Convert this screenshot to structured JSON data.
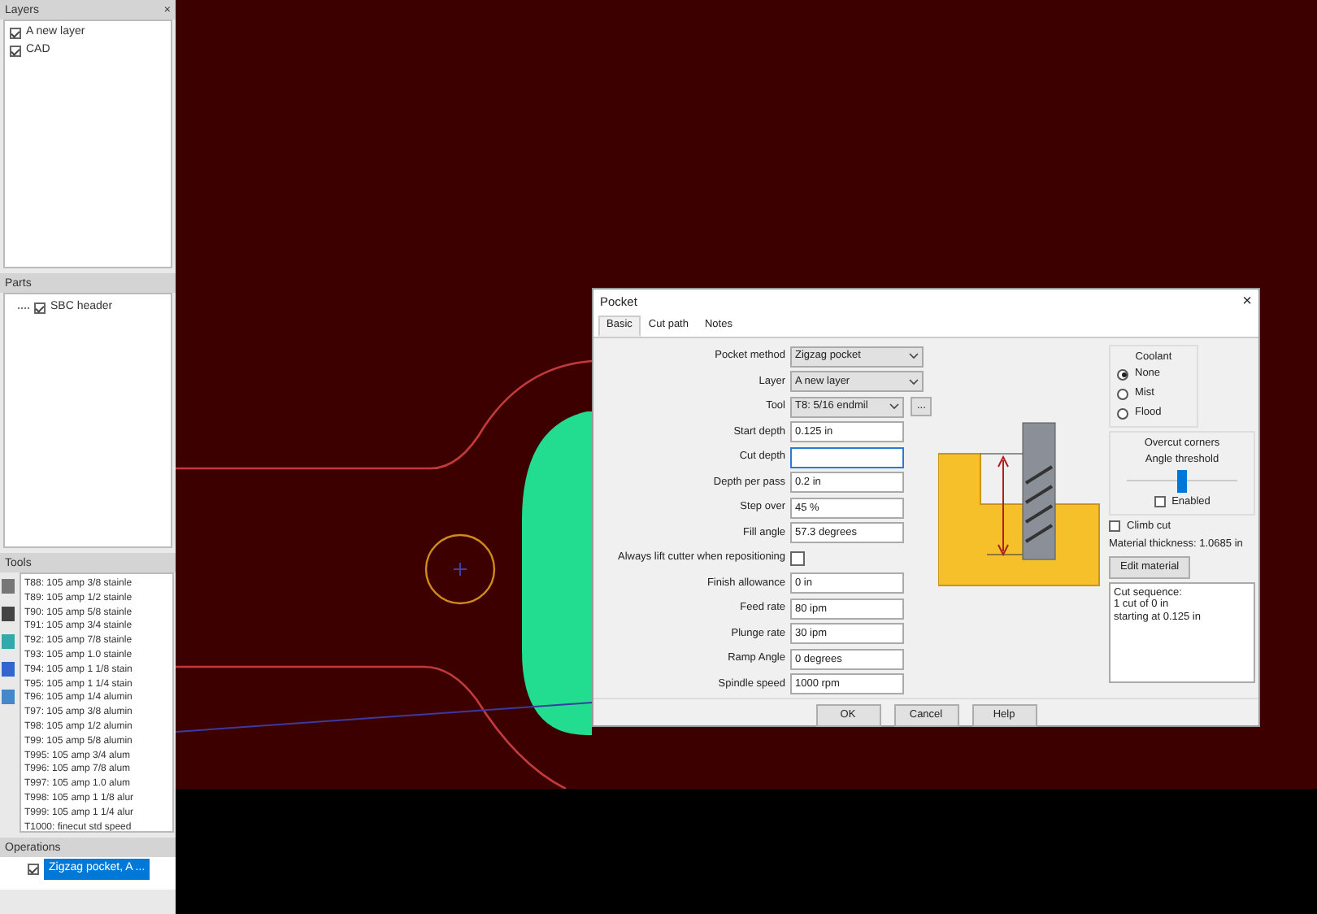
{
  "layers_panel": {
    "title": "Layers",
    "close": "×",
    "items": [
      {
        "label": "A new layer",
        "checked": true
      },
      {
        "label": "CAD",
        "checked": true
      }
    ]
  },
  "parts_panel": {
    "title": "Parts",
    "items": [
      {
        "label": "SBC header",
        "checked": true
      }
    ]
  },
  "tools_panel": {
    "title": "Tools",
    "items": [
      "T88: 105 amp 3/8 stainle",
      "T89: 105 amp 1/2 stainle",
      "T90: 105 amp 5/8 stainle",
      "T91: 105 amp 3/4 stainle",
      "T92: 105 amp 7/8 stainle",
      "T93: 105 amp 1.0 stainle",
      "T94: 105 amp 1 1/8 stain",
      "T95: 105 amp 1 1/4 stain",
      "T96: 105 amp 1/4 alumin",
      "T97: 105 amp 3/8 alumin",
      "T98: 105 amp 1/2 alumin",
      "T99: 105 amp 5/8 alumin",
      "T995: 105 amp 3/4 alum",
      "T996: 105 amp 7/8 alum",
      "T997: 105 amp 1.0 alum",
      "T998: 105 amp 1 1/8 alur",
      "T999: 105 amp 1 1/4 alur",
      "T1000: finecut std speed"
    ]
  },
  "operations_panel": {
    "title": "Operations",
    "items": [
      {
        "label": "Zigzag pocket, A ...",
        "checked": true,
        "selected": true
      }
    ]
  },
  "dialog": {
    "title": "Pocket",
    "close": "×",
    "tabs": [
      {
        "label": "Basic",
        "selected": true
      },
      {
        "label": "Cut path",
        "selected": false
      },
      {
        "label": "Notes",
        "selected": false
      }
    ],
    "fields": [
      {
        "kind": "select",
        "label": "Pocket method",
        "value": "Zigzag pocket"
      },
      {
        "kind": "select",
        "label": "Layer",
        "value": "A new layer"
      },
      {
        "kind": "select_button",
        "label": "Tool",
        "value": "T8: 5/16 endmil",
        "button": "..."
      },
      {
        "kind": "text",
        "label": "Start depth",
        "value": "0.125 in",
        "focused": false
      },
      {
        "kind": "text",
        "label": "Cut depth",
        "focused": true
      },
      {
        "kind": "text",
        "label": "Depth per pass",
        "value": "0.2 in",
        "focused": false
      },
      {
        "kind": "text",
        "label": "Step over",
        "value": "45 %",
        "focused": false
      },
      {
        "kind": "text",
        "label": "Fill angle",
        "value": "57.3 degrees",
        "focused": false
      },
      {
        "kind": "checkbox",
        "label": "Always lift cutter when repositioning",
        "checked": false
      },
      {
        "kind": "text",
        "label": "Finish allowance",
        "value": "0 in",
        "focused": false
      },
      {
        "kind": "text",
        "label": "Feed rate",
        "value": "80 ipm",
        "focused": false
      },
      {
        "kind": "text",
        "label": "Plunge rate",
        "value": "30 ipm",
        "focused": false
      },
      {
        "kind": "text",
        "label": "Ramp Angle",
        "value": "0 degrees",
        "focused": false
      },
      {
        "kind": "text",
        "label": "Spindle speed",
        "value": "1000 rpm",
        "focused": false
      }
    ],
    "coolant": {
      "title": "Coolant",
      "options": [
        {
          "label": "None",
          "selected": true
        },
        {
          "label": "Mist",
          "selected": false
        },
        {
          "label": "Flood",
          "selected": false
        }
      ]
    },
    "overcut": {
      "title": "Overcut corners",
      "slider_label": "Angle threshold",
      "level": 0.5,
      "enabled": {
        "label": "Enabled",
        "checked": false
      }
    },
    "climb_cut": {
      "label": "Climb cut",
      "checked": false
    },
    "material_thickness": "Material thickness: 1.0685 in",
    "edit_material": "Edit material",
    "cut_sequence": [
      "Cut sequence:",
      "1 cut of 0 in",
      "starting at 0.125 in"
    ],
    "buttons": [
      "OK",
      "Cancel",
      "Help"
    ]
  }
}
